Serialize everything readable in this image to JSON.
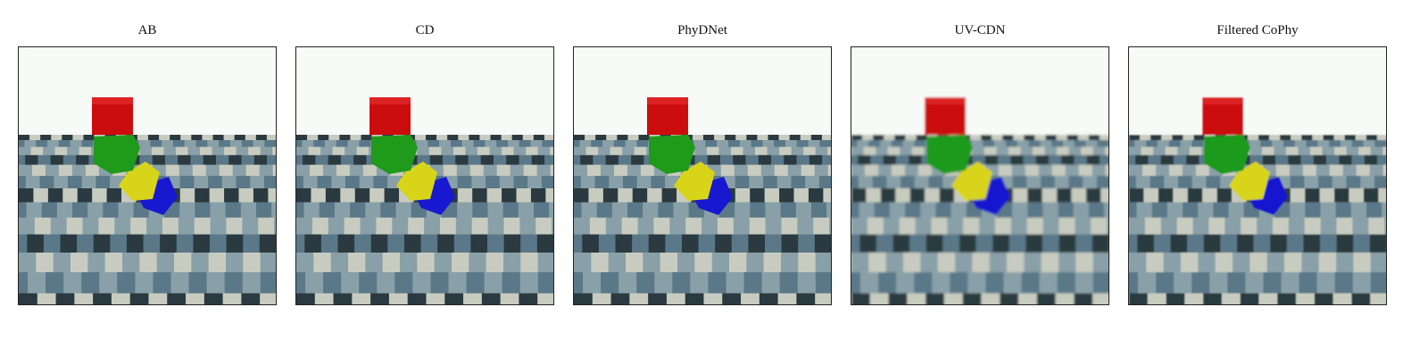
{
  "panels": [
    {
      "title": "AB",
      "blur": 0,
      "tilt": 0
    },
    {
      "title": "CD",
      "blur": 0,
      "tilt": 0
    },
    {
      "title": "PhyDNet",
      "blur": 0,
      "tilt": 0
    },
    {
      "title": "UV-CDN",
      "blur": 1.2,
      "tilt": 0
    },
    {
      "title": "Filtered CoPhy",
      "blur": 0.8,
      "tilt": 0
    }
  ],
  "scene": {
    "sky_color": "#f8faf8",
    "cube_colors": [
      "#cc0d0d",
      "#1f9a1a",
      "#d8d41a",
      "#1818d0"
    ],
    "floor_colors": [
      "#2a3a40",
      "#8aa0a8",
      "#c8ccc0",
      "#5a7888"
    ]
  }
}
